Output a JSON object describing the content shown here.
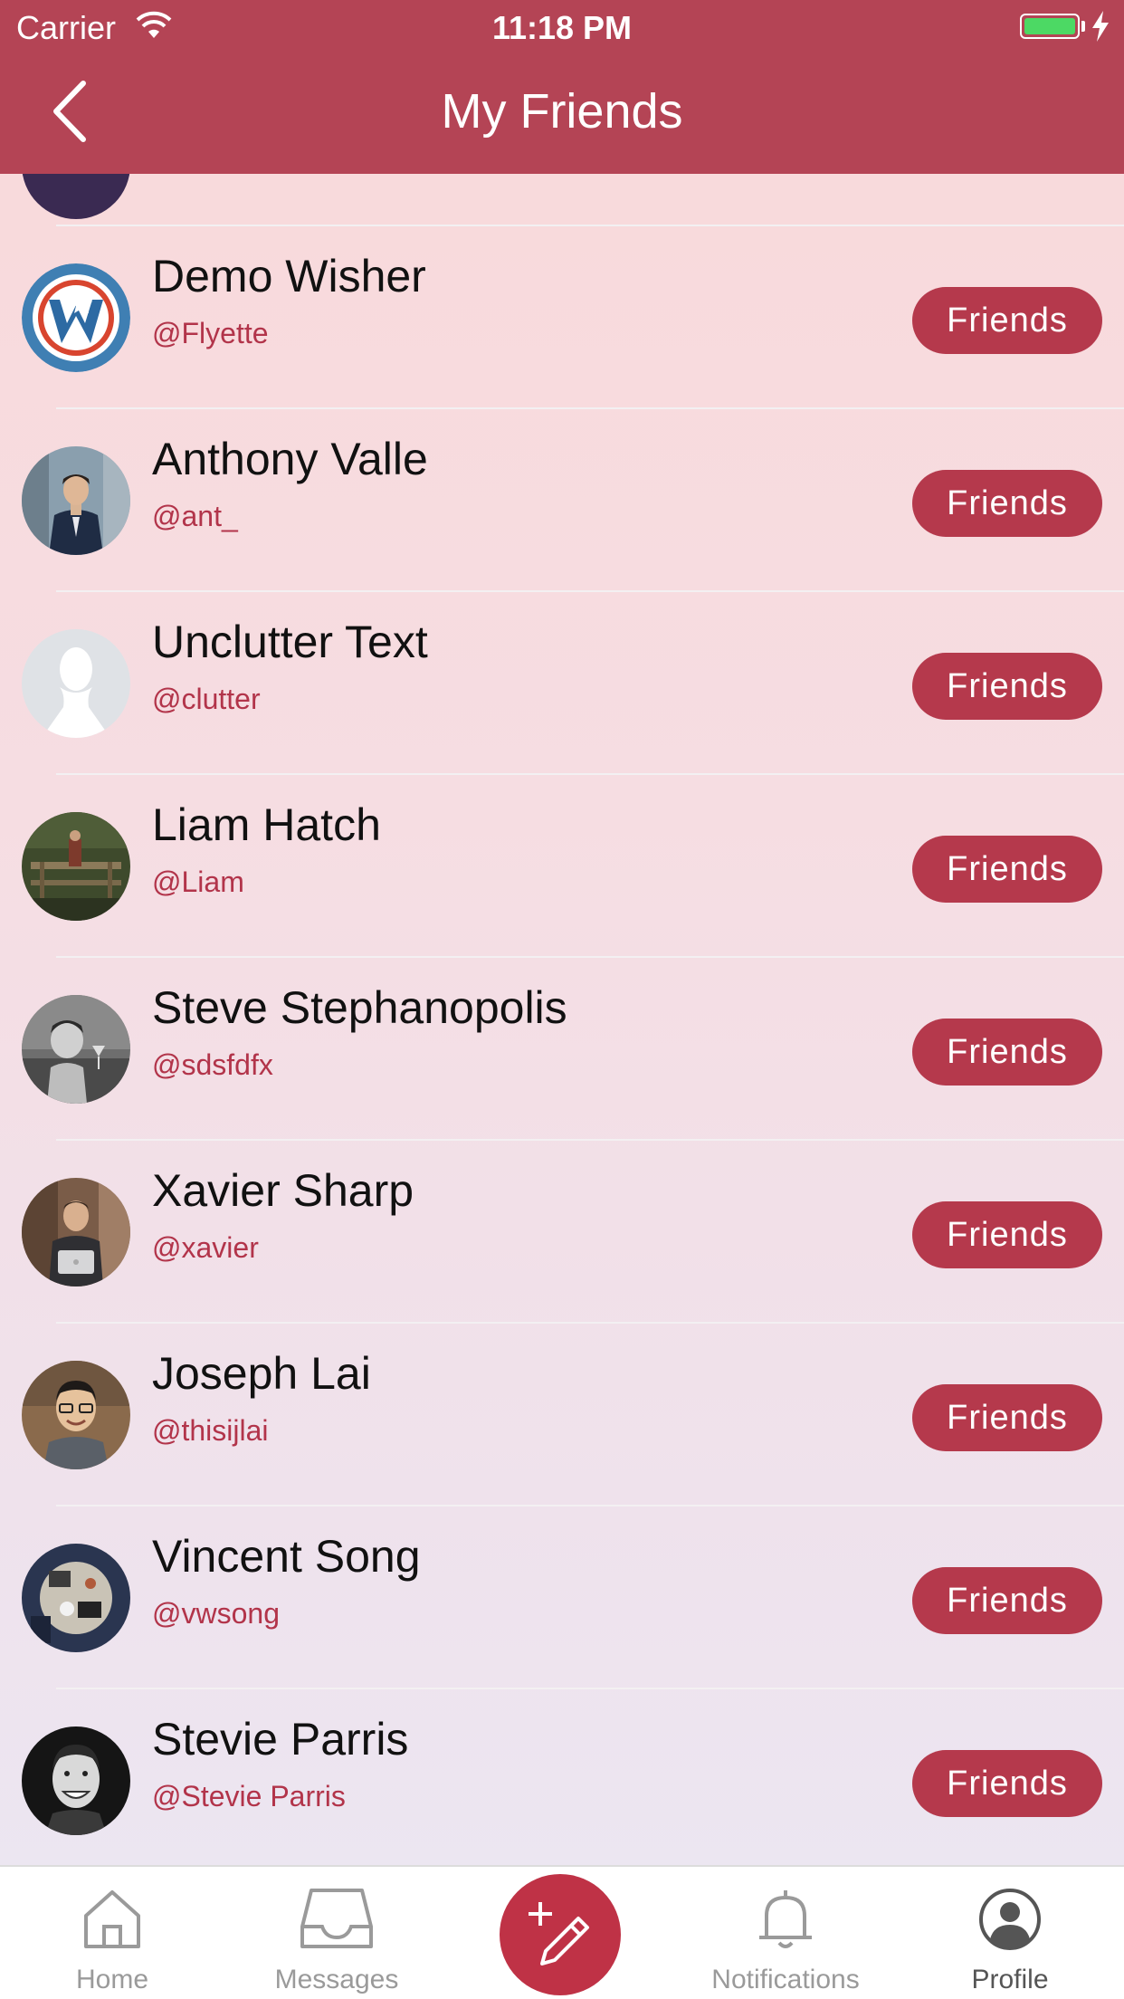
{
  "status_bar": {
    "carrier": "Carrier",
    "time": "11:18 PM"
  },
  "nav": {
    "title": "My Friends"
  },
  "friends": [
    {
      "name": "Demo Wisher",
      "handle": "@Flyette",
      "button": "Friends"
    },
    {
      "name": "Anthony Valle",
      "handle": "@ant_",
      "button": "Friends"
    },
    {
      "name": "Unclutter Text",
      "handle": "@clutter",
      "button": "Friends"
    },
    {
      "name": "Liam Hatch",
      "handle": "@Liam",
      "button": "Friends"
    },
    {
      "name": "Steve Stephanopolis",
      "handle": "@sdsfdfx",
      "button": "Friends"
    },
    {
      "name": "Xavier Sharp",
      "handle": "@xavier",
      "button": "Friends"
    },
    {
      "name": "Joseph Lai",
      "handle": "@thisijlai",
      "button": "Friends"
    },
    {
      "name": "Vincent Song",
      "handle": "@vwsong",
      "button": "Friends"
    },
    {
      "name": "Stevie Parris",
      "handle": "@Stevie Parris",
      "button": "Friends"
    }
  ],
  "tabbar": {
    "home": "Home",
    "messages": "Messages",
    "notifications": "Notifications",
    "profile": "Profile",
    "active": "Profile"
  },
  "colors": {
    "brand": "#b44455",
    "button": "#b5394c",
    "handle": "#b2344a",
    "compose": "#bf3246"
  },
  "icons": {
    "back": "chevron-left-icon",
    "home": "home-icon",
    "messages": "inbox-icon",
    "compose": "compose-icon",
    "notifications": "bell-icon",
    "profile": "user-circle-icon"
  }
}
